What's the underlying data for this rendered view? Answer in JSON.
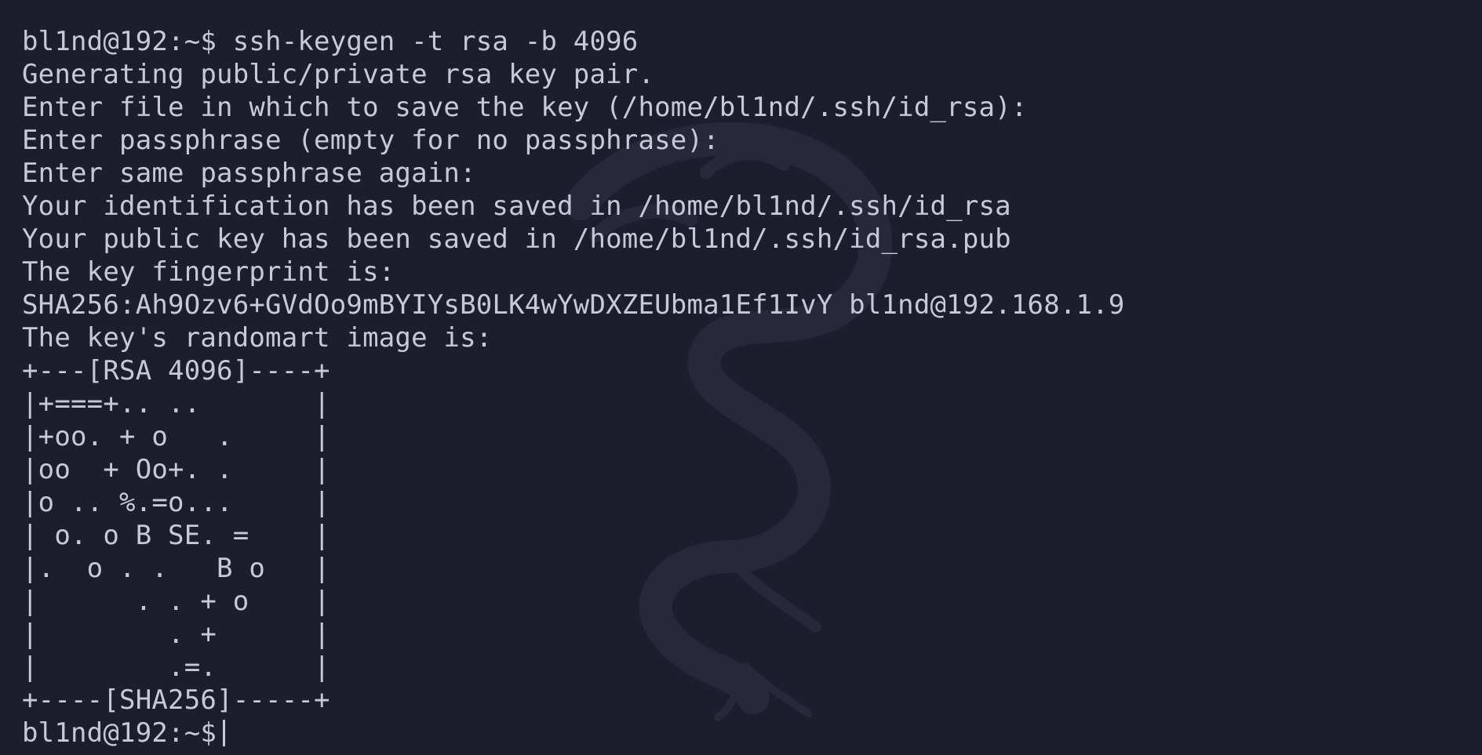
{
  "terminal": {
    "colors": {
      "background": "#1c1e2e",
      "foreground": "#c7c9d8"
    },
    "watermark_icon": "kali-dragon-icon",
    "lines": [
      "bl1nd@192:~$ ssh-keygen -t rsa -b 4096",
      "Generating public/private rsa key pair.",
      "Enter file in which to save the key (/home/bl1nd/.ssh/id_rsa):",
      "Enter passphrase (empty for no passphrase):",
      "Enter same passphrase again:",
      "Your identification has been saved in /home/bl1nd/.ssh/id_rsa",
      "Your public key has been saved in /home/bl1nd/.ssh/id_rsa.pub",
      "The key fingerprint is:",
      "SHA256:Ah9Ozv6+GVdOo9mBYIYsB0LK4wYwDXZEUbma1Ef1IvY bl1nd@192.168.1.9",
      "The key's randomart image is:",
      "+---[RSA 4096]----+",
      "|+===+.. ..       |",
      "|+oo. + o   .     |",
      "|oo  + Oo+. .     |",
      "|o .. %.=o...     |",
      "| o. o B SE. =    |",
      "|.  o . .   B o   |",
      "|      . . + o    |",
      "|        . +      |",
      "|        .=.      |",
      "+----[SHA256]-----+"
    ],
    "prompt": "bl1nd@192:~$"
  }
}
